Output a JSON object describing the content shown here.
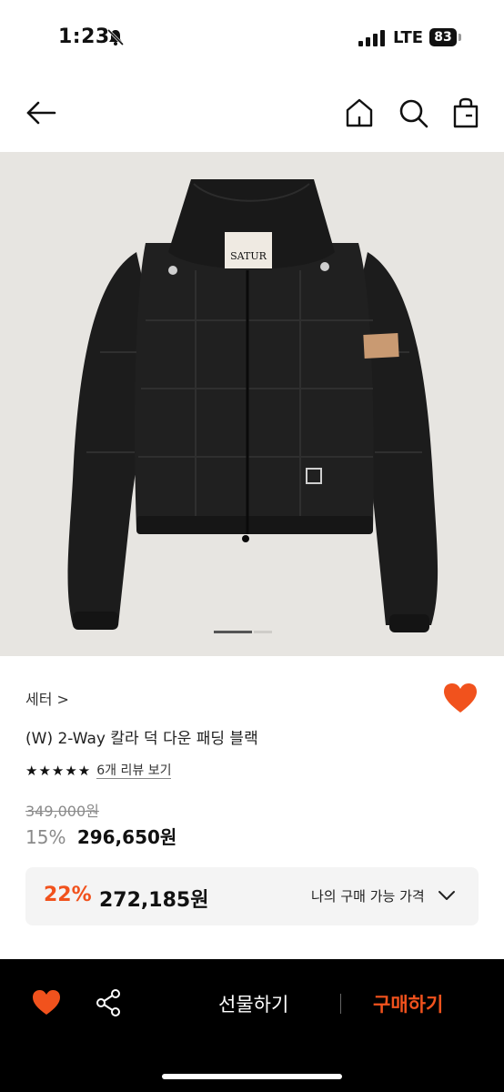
{
  "status_bar": {
    "time": "1:23",
    "network": "LTE",
    "battery": "83"
  },
  "product": {
    "brand": "세터",
    "brand_chevron": ">",
    "title": "(W) 2-Way 칼라 덕 다운 패딩 블랙",
    "stars": "★★★★★",
    "rating_value": 5,
    "review_link": "6개 리뷰 보기",
    "original_price": "349,000원",
    "sale_percent": "15%",
    "sale_price": "296,650원",
    "image_label": "SATUR",
    "image_index": 1
  },
  "member_price": {
    "percent": "22%",
    "price": "272,185원",
    "label": "나의 구매 가능 가격"
  },
  "bottom_bar": {
    "gift_label": "선물하기",
    "buy_label": "구매하기"
  },
  "colors": {
    "accent": "#f1521d",
    "black": "#000000",
    "image_bg": "#e7e5e1"
  },
  "icons": [
    "bell-slash-icon",
    "signal-icon",
    "back-arrow-icon",
    "home-icon",
    "search-icon",
    "shopping-bag-icon",
    "heart-icon",
    "share-icon",
    "chevron-down-icon"
  ]
}
